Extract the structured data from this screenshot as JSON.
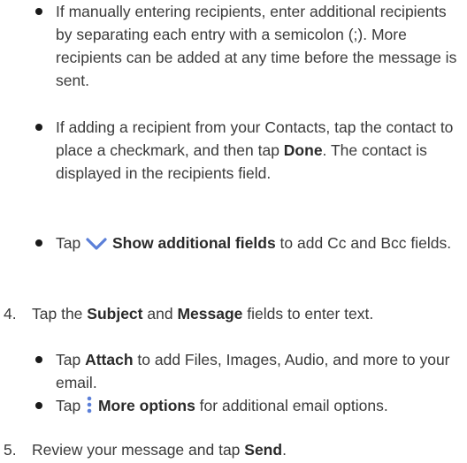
{
  "bullets_top": [
    {
      "text": "If manually entering recipients, enter additional recipients by separating each entry with a semicolon (;). More recipients can be added at any time before the message is sent."
    },
    {
      "text_before": "If adding a recipient from your Contacts, tap the contact to place a checkmark, and then tap ",
      "bold": "Done",
      "text_after": ". The contact is displayed in the recipients field."
    },
    {
      "text_before": "Tap ",
      "icon": "chevron-down-icon",
      "bold": "Show additional fields",
      "text_after": " to add Cc and Bcc fields."
    }
  ],
  "step4": {
    "number": "4.",
    "text_1": "Tap the ",
    "bold_1": "Subject",
    "text_2": " and ",
    "bold_2": "Message",
    "text_3": " fields to enter text."
  },
  "bullets_step4": [
    {
      "text_before": "Tap ",
      "bold": "Attach",
      "text_after": " to add Files, Images, Audio, and more to your email."
    },
    {
      "text_before": "Tap ",
      "icon": "more-options-icon",
      "bold": "More options",
      "text_after": " for additional email options."
    }
  ],
  "step5": {
    "number": "5.",
    "text_1": "Review your message and tap ",
    "bold_1": "Send",
    "text_2": "."
  },
  "colors": {
    "icon_blue": "#5b7fd8",
    "text": "#3a3a3a"
  }
}
